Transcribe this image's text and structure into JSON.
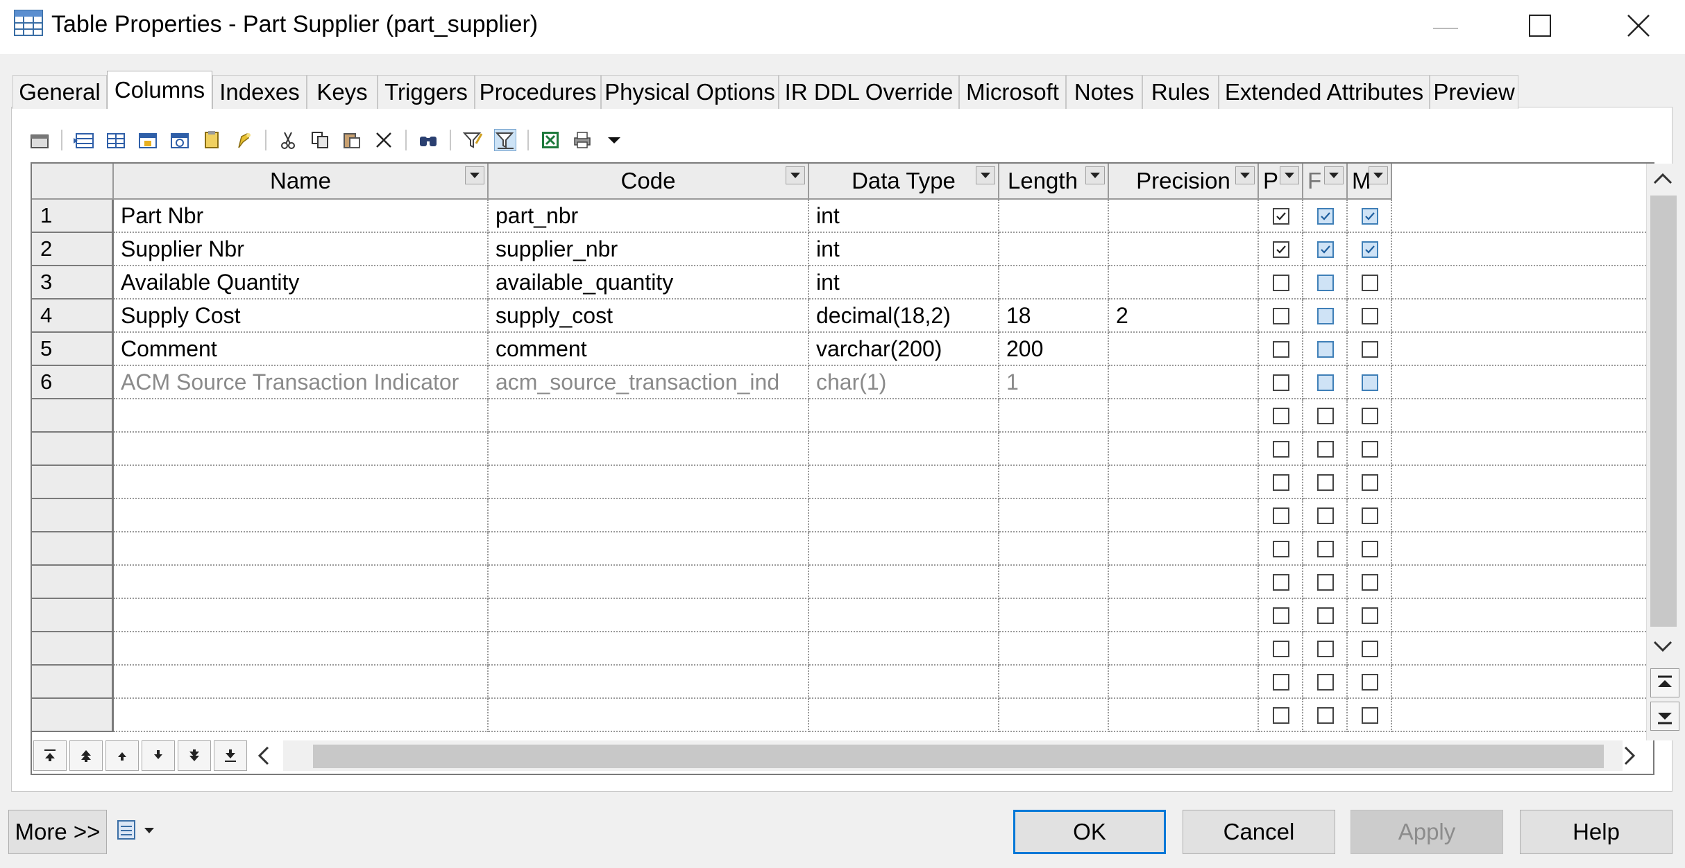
{
  "window": {
    "title": "Table Properties - Part Supplier (part_supplier)"
  },
  "tabs": [
    {
      "label": "General"
    },
    {
      "label": "Columns"
    },
    {
      "label": "Indexes"
    },
    {
      "label": "Keys"
    },
    {
      "label": "Triggers"
    },
    {
      "label": "Procedures"
    },
    {
      "label": "Physical Options"
    },
    {
      "label": "IR DDL Override"
    },
    {
      "label": "Microsoft"
    },
    {
      "label": "Notes"
    },
    {
      "label": "Rules"
    },
    {
      "label": "Extended Attributes"
    },
    {
      "label": "Preview"
    }
  ],
  "active_tab": "Columns",
  "toolbar": {
    "icons": [
      "properties-icon",
      "insert-row-icon",
      "add-row-icon",
      "add-columns-icon",
      "reuse-columns-icon",
      "paste-icon",
      "new-icon",
      "cut-icon",
      "copy-icon",
      "paste-icon",
      "delete-icon",
      "find-icon",
      "filter-icon",
      "filter-active-icon",
      "excel-export-icon",
      "print-icon",
      "dropdown-arrow-icon"
    ]
  },
  "grid": {
    "headers": [
      "Name",
      "Code",
      "Data Type",
      "Length",
      "Precision",
      "P",
      "F",
      "M"
    ],
    "rows": [
      {
        "num": "1",
        "name": "Part Nbr",
        "code": "part_nbr",
        "datatype": "int",
        "length": "",
        "precision": "",
        "p": true,
        "f": true,
        "m": true,
        "inherited": false
      },
      {
        "num": "2",
        "name": "Supplier Nbr",
        "code": "supplier_nbr",
        "datatype": "int",
        "length": "",
        "precision": "",
        "p": true,
        "f": true,
        "m": true,
        "inherited": false
      },
      {
        "num": "3",
        "name": "Available Quantity",
        "code": "available_quantity",
        "datatype": "int",
        "length": "",
        "precision": "",
        "p": false,
        "f": false,
        "m": false,
        "inherited": false
      },
      {
        "num": "4",
        "name": "Supply Cost",
        "code": "supply_cost",
        "datatype": "decimal(18,2)",
        "length": "18",
        "precision": "2",
        "p": false,
        "f": false,
        "m": false,
        "inherited": false
      },
      {
        "num": "5",
        "name": "Comment",
        "code": "comment",
        "datatype": "varchar(200)",
        "length": "200",
        "precision": "",
        "p": false,
        "f": false,
        "m": false,
        "inherited": false
      },
      {
        "num": "6",
        "name": "ACM Source Transaction Indicator",
        "code": "acm_source_transaction_ind",
        "datatype": "char(1)",
        "length": "1",
        "precision": "",
        "p": false,
        "f": false,
        "m": false,
        "inherited": true
      }
    ],
    "empty_rows": 10
  },
  "footer": {
    "more_label": "More >>",
    "ok_label": "OK",
    "cancel_label": "Cancel",
    "apply_label": "Apply",
    "help_label": "Help"
  },
  "colors": {
    "accent": "#0078d7",
    "fk_checkbox": "#3f7fb7",
    "inherited_text": "#8a8a8a"
  }
}
